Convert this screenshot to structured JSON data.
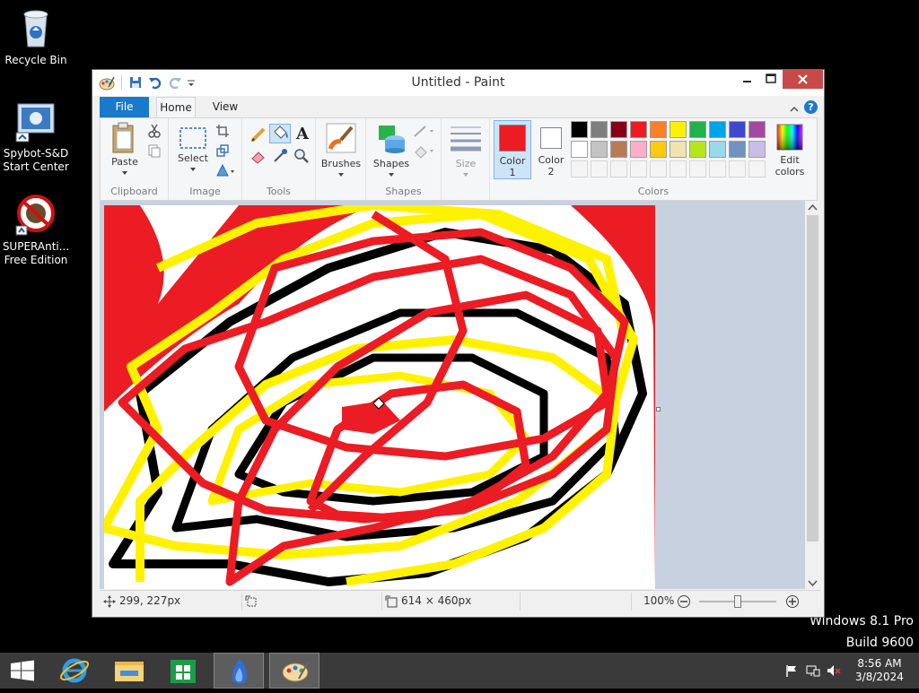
{
  "desktop": {
    "icons": [
      {
        "label": "Recycle Bin",
        "icon": "recycle-bin-icon"
      },
      {
        "label": "Spybot-S&D Start Center",
        "icon": "spybot-icon"
      },
      {
        "label": "SUPERAnti... Free Edition",
        "icon": "superantispyware-icon"
      }
    ],
    "watermark_line1": "Windows 8.1 Pro",
    "watermark_line2": "Build 9600"
  },
  "window": {
    "title": "Untitled - Paint",
    "tabs": {
      "file": "File",
      "home": "Home",
      "view": "View"
    },
    "help": "?"
  },
  "ribbon": {
    "clipboard": {
      "paste": "Paste",
      "group": "Clipboard"
    },
    "image": {
      "select": "Select",
      "group": "Image"
    },
    "tools": {
      "group": "Tools"
    },
    "brushes": {
      "label": "Brushes"
    },
    "shapes": {
      "label": "Shapes",
      "group": "Shapes"
    },
    "size": {
      "label": "Size"
    },
    "color1": {
      "label": "Color",
      "num": "1",
      "value": "#ec1c24"
    },
    "color2": {
      "label": "Color",
      "num": "2",
      "value": "#ffffff"
    },
    "edit_colors": {
      "line1": "Edit",
      "line2": "colors"
    },
    "colors_group": "Colors",
    "palette_row1": [
      "#000000",
      "#7f7f7f",
      "#880015",
      "#ed1c24",
      "#ff7f27",
      "#fff200",
      "#22b14c",
      "#00a2e8",
      "#3f48cc",
      "#a349a4"
    ],
    "palette_row2": [
      "#ffffff",
      "#c3c3c3",
      "#b97a57",
      "#ffaec9",
      "#ffc90e",
      "#efe4b0",
      "#b5e61d",
      "#99d9ea",
      "#7092be",
      "#c8bfe7"
    ],
    "palette_row3": [
      "#f5f5f5",
      "#f5f5f5",
      "#f5f5f5",
      "#f5f5f5",
      "#f5f5f5",
      "#f5f5f5",
      "#f5f5f5",
      "#f5f5f5",
      "#f5f5f5",
      "#f5f5f5"
    ]
  },
  "status": {
    "cursor_pos": "299, 227px",
    "canvas_size": "614 × 460px",
    "zoom": "100%"
  },
  "taskbar": {
    "time": "8:56 AM",
    "date": "3/8/2024"
  }
}
